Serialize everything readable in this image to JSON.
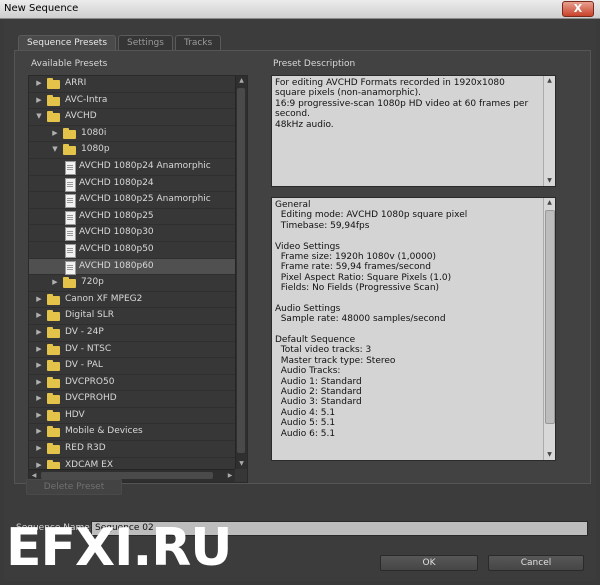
{
  "window": {
    "title": "New Sequence",
    "close_label": "X"
  },
  "tabs": [
    {
      "label": "Sequence Presets",
      "active": true
    },
    {
      "label": "Settings",
      "active": false
    },
    {
      "label": "Tracks",
      "active": false
    }
  ],
  "presets_panel": {
    "heading": "Available Presets"
  },
  "tree": [
    {
      "label": "ARRI",
      "type": "folder",
      "level": 0,
      "expanded": false,
      "selected": false
    },
    {
      "label": "AVC-Intra",
      "type": "folder",
      "level": 0,
      "expanded": false,
      "selected": false
    },
    {
      "label": "AVCHD",
      "type": "folder",
      "level": 0,
      "expanded": true,
      "selected": false
    },
    {
      "label": "1080i",
      "type": "folder",
      "level": 1,
      "expanded": false,
      "selected": false
    },
    {
      "label": "1080p",
      "type": "folder",
      "level": 1,
      "expanded": true,
      "selected": false
    },
    {
      "label": "AVCHD 1080p24 Anamorphic",
      "type": "file",
      "level": 2,
      "selected": false
    },
    {
      "label": "AVCHD 1080p24",
      "type": "file",
      "level": 2,
      "selected": false
    },
    {
      "label": "AVCHD 1080p25 Anamorphic",
      "type": "file",
      "level": 2,
      "selected": false
    },
    {
      "label": "AVCHD 1080p25",
      "type": "file",
      "level": 2,
      "selected": false
    },
    {
      "label": "AVCHD 1080p30",
      "type": "file",
      "level": 2,
      "selected": false
    },
    {
      "label": "AVCHD 1080p50",
      "type": "file",
      "level": 2,
      "selected": false
    },
    {
      "label": "AVCHD 1080p60",
      "type": "file",
      "level": 2,
      "selected": true
    },
    {
      "label": "720p",
      "type": "folder",
      "level": 1,
      "expanded": false,
      "selected": false
    },
    {
      "label": "Canon XF MPEG2",
      "type": "folder",
      "level": 0,
      "expanded": false,
      "selected": false
    },
    {
      "label": "Digital SLR",
      "type": "folder",
      "level": 0,
      "expanded": false,
      "selected": false
    },
    {
      "label": "DV - 24P",
      "type": "folder",
      "level": 0,
      "expanded": false,
      "selected": false
    },
    {
      "label": "DV - NTSC",
      "type": "folder",
      "level": 0,
      "expanded": false,
      "selected": false
    },
    {
      "label": "DV - PAL",
      "type": "folder",
      "level": 0,
      "expanded": false,
      "selected": false
    },
    {
      "label": "DVCPRO50",
      "type": "folder",
      "level": 0,
      "expanded": false,
      "selected": false
    },
    {
      "label": "DVCPROHD",
      "type": "folder",
      "level": 0,
      "expanded": false,
      "selected": false
    },
    {
      "label": "HDV",
      "type": "folder",
      "level": 0,
      "expanded": false,
      "selected": false
    },
    {
      "label": "Mobile & Devices",
      "type": "folder",
      "level": 0,
      "expanded": false,
      "selected": false
    },
    {
      "label": "RED R3D",
      "type": "folder",
      "level": 0,
      "expanded": false,
      "selected": false
    },
    {
      "label": "XDCAM EX",
      "type": "folder",
      "level": 0,
      "expanded": false,
      "selected": false
    }
  ],
  "description_panel": {
    "heading": "Preset Description",
    "text": "For editing AVCHD Formats recorded in 1920x1080 square pixels (non-anamorphic).\n16:9 progressive-scan 1080p HD video at 60 frames per second.\n48kHz audio."
  },
  "general_info": {
    "lines": [
      "General",
      "  Editing mode: AVCHD 1080p square pixel",
      "  Timebase: 59,94fps",
      "",
      "Video Settings",
      "  Frame size: 1920h 1080v (1,0000)",
      "  Frame rate: 59,94 frames/second",
      "  Pixel Aspect Ratio: Square Pixels (1.0)",
      "  Fields: No Fields (Progressive Scan)",
      "",
      "Audio Settings",
      "  Sample rate: 48000 samples/second",
      "",
      "Default Sequence",
      "  Total video tracks: 3",
      "  Master track type: Stereo",
      "  Audio Tracks:",
      "  Audio 1: Standard",
      "  Audio 2: Standard",
      "  Audio 3: Standard",
      "  Audio 4: 5.1",
      "  Audio 5: 5.1",
      "  Audio 6: 5.1"
    ]
  },
  "buttons": {
    "delete_preset": "Delete Preset",
    "ok": "OK",
    "cancel": "Cancel"
  },
  "sequence_name": {
    "label": "Sequence Name:",
    "value": "Sequence 02"
  },
  "watermark": "EFXI.RU"
}
